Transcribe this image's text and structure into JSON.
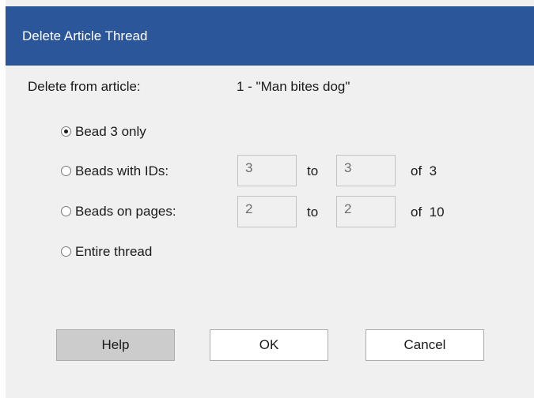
{
  "window": {
    "title": "Delete Article Thread"
  },
  "article": {
    "label": "Delete from article:",
    "value": "1 - \"Man bites dog\""
  },
  "options": {
    "bead_only": {
      "label": "Bead 3 only",
      "selected": true
    },
    "beads_ids": {
      "label": "Beads with IDs:",
      "from": "3",
      "to_label": "to",
      "to": "3",
      "of_label": "of  3",
      "selected": false
    },
    "beads_pages": {
      "label": "Beads on pages:",
      "from": "2",
      "to_label": "to",
      "to": "2",
      "of_label": "of  10",
      "selected": false
    },
    "entire": {
      "label": "Entire thread",
      "selected": false
    }
  },
  "buttons": {
    "help": "Help",
    "ok": "OK",
    "cancel": "Cancel"
  },
  "colors": {
    "titlebar": "#2b579a",
    "background": "#f0f0f0"
  }
}
